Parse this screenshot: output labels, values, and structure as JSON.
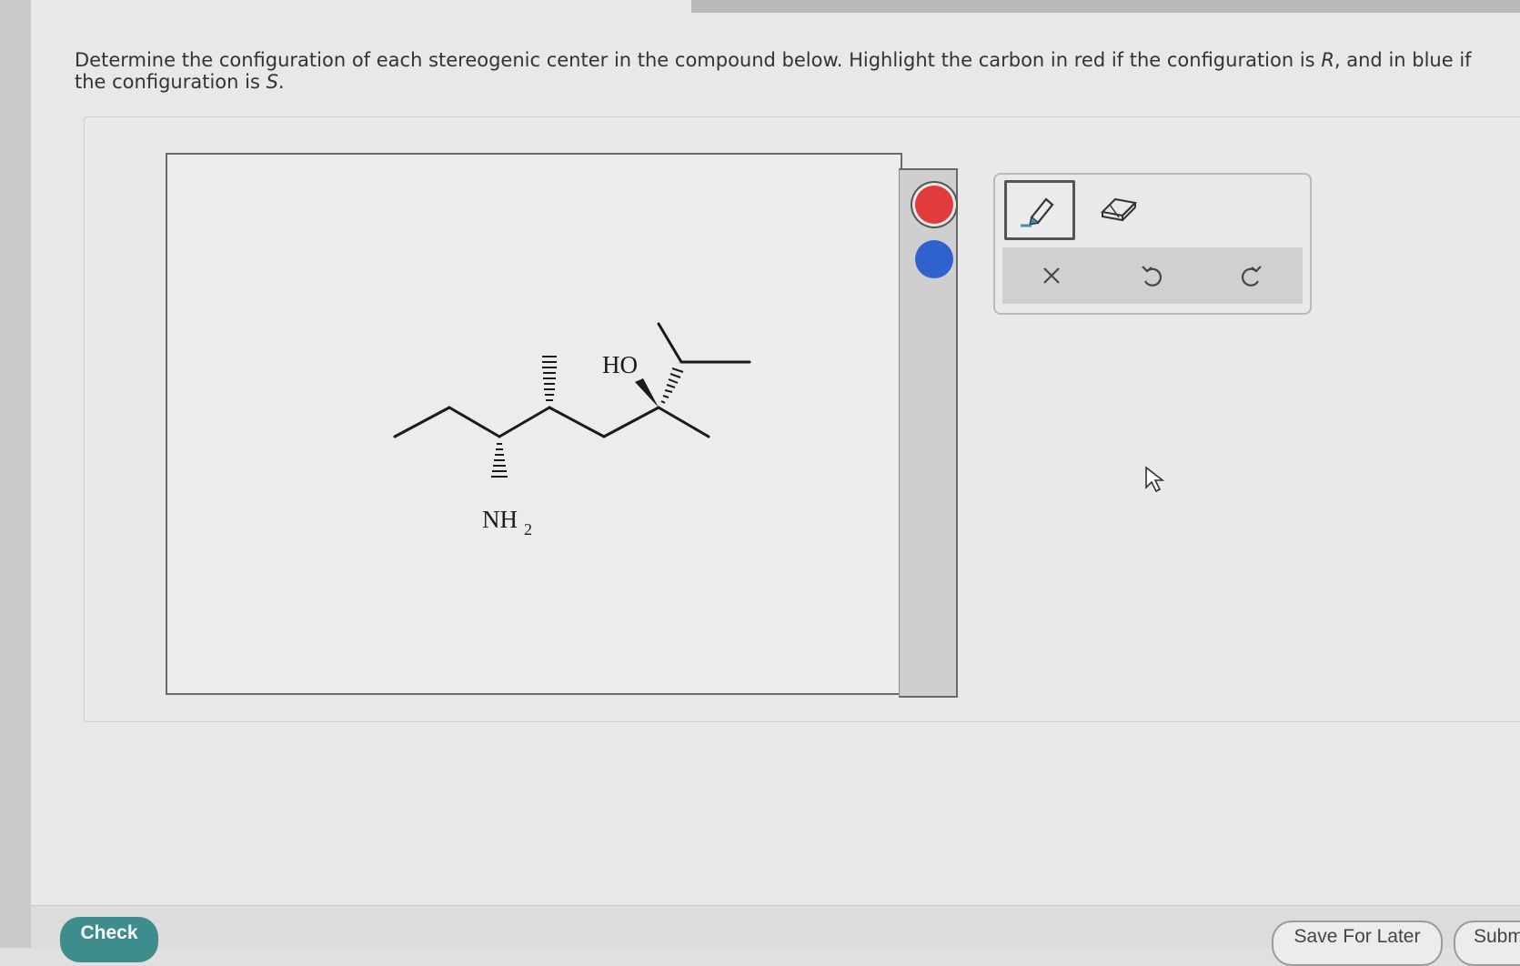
{
  "question": {
    "text_before_R": "Determine the configuration of each stereogenic center in the compound below. Highlight the carbon in red if the configuration is ",
    "R": "R",
    "text_between": ", and in blue if the configuration is ",
    "S": "S",
    "text_end": "."
  },
  "molecule": {
    "ho_label": "HO",
    "nh_label": "NH",
    "nh_subscript": "2"
  },
  "colors": {
    "red": "#e23b3b",
    "blue": "#2f62cf"
  },
  "toolbar": {
    "tools": [
      "pencil-icon",
      "eraser-icon"
    ],
    "actions": [
      "clear-icon",
      "undo-icon",
      "redo-icon"
    ]
  },
  "buttons": {
    "check": "Check",
    "save_for_later": "Save For Later",
    "submit": "Subm"
  }
}
